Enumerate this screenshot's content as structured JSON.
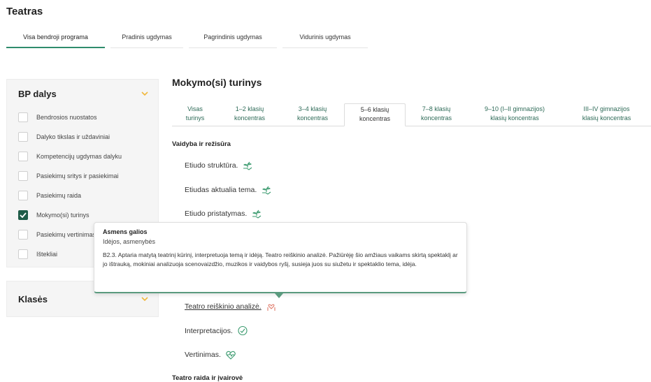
{
  "page": {
    "title": "Teatras"
  },
  "top_tabs": [
    {
      "label": "Visa bendroji programa",
      "active": true
    },
    {
      "label": "Pradinis ugdymas",
      "active": false
    },
    {
      "label": "Pagrindinis ugdymas",
      "active": false
    },
    {
      "label": "Vidurinis ugdymas",
      "active": false
    }
  ],
  "sidebar": {
    "bp_title": "BP dalys",
    "items": [
      {
        "label": "Bendrosios nuostatos",
        "checked": false
      },
      {
        "label": "Dalyko tikslas ir uždaviniai",
        "checked": false
      },
      {
        "label": "Kompetencijų ugdymas dalyku",
        "checked": false
      },
      {
        "label": "Pasiekimų sritys ir pasiekimai",
        "checked": false
      },
      {
        "label": "Pasiekimų raida",
        "checked": false
      },
      {
        "label": "Mokymo(si) turinys",
        "checked": true
      },
      {
        "label": "Pasiekimų vertinimas",
        "checked": false
      },
      {
        "label": "Ištekliai",
        "checked": false
      }
    ],
    "klases_title": "Klasės",
    "accent": "#f0b73c",
    "checked_color": "#1f5c48"
  },
  "main": {
    "title": "Mokymo(si) turinys",
    "sub_tabs": [
      {
        "line1": "Visas",
        "line2": "turinys",
        "active": false
      },
      {
        "line1": "1–2 klasių",
        "line2": "koncentras",
        "active": false
      },
      {
        "line1": "3–4 klasių",
        "line2": "koncentras",
        "active": false
      },
      {
        "line1": "5–6 klasių",
        "line2": "koncentras",
        "active": true
      },
      {
        "line1": "7–8 klasių",
        "line2": "koncentras",
        "active": false
      },
      {
        "line1": "9–10 (I–II gimnazijos)",
        "line2": "klasių koncentras",
        "active": false
      },
      {
        "line1": "III–IV gimnazijos",
        "line2": "klasių koncentras",
        "active": false
      }
    ],
    "section1": "Vaidyba ir režisūra",
    "topics_top": [
      {
        "label": "Etiudo struktūra.",
        "icon": "seedling-hand-icon"
      },
      {
        "label": "Etiudas aktualia tema.",
        "icon": "seedling-hand-icon"
      },
      {
        "label": "Etiudo pristatymas.",
        "icon": "seedling-hand-icon"
      }
    ],
    "topics_bottom": [
      {
        "label": "Teatro reiškinio analizė.",
        "icon": "heart-hands-icon",
        "link": true
      },
      {
        "label": "Interpretacijos.",
        "icon": "thinking-head-icon",
        "link": false
      },
      {
        "label": "Vertinimas.",
        "icon": "heart-pulse-icon",
        "link": false
      }
    ],
    "section2": "Teatro raida ir įvairovė"
  },
  "tooltip": {
    "title": "Asmens galios",
    "subtitle": "Idėjos, asmenybės",
    "body": "B2.3. Aptaria matytą teatrinį kūrinį, interpretuoja temą ir idėją. Teatro reiškinio analizė. Pažiūrėję šio amžiaus vaikams skirtą spektaklį ar jo ištrauką, mokiniai analizuoja scenovaizdžio, muzikos ir vaidybos ryšį, susieja juos su siužetu ir spektaklio tema, idėja."
  },
  "colors": {
    "green": "#2f8c6c",
    "dark_green": "#1f5c48",
    "tooltip_border": "#5a9a7e"
  }
}
